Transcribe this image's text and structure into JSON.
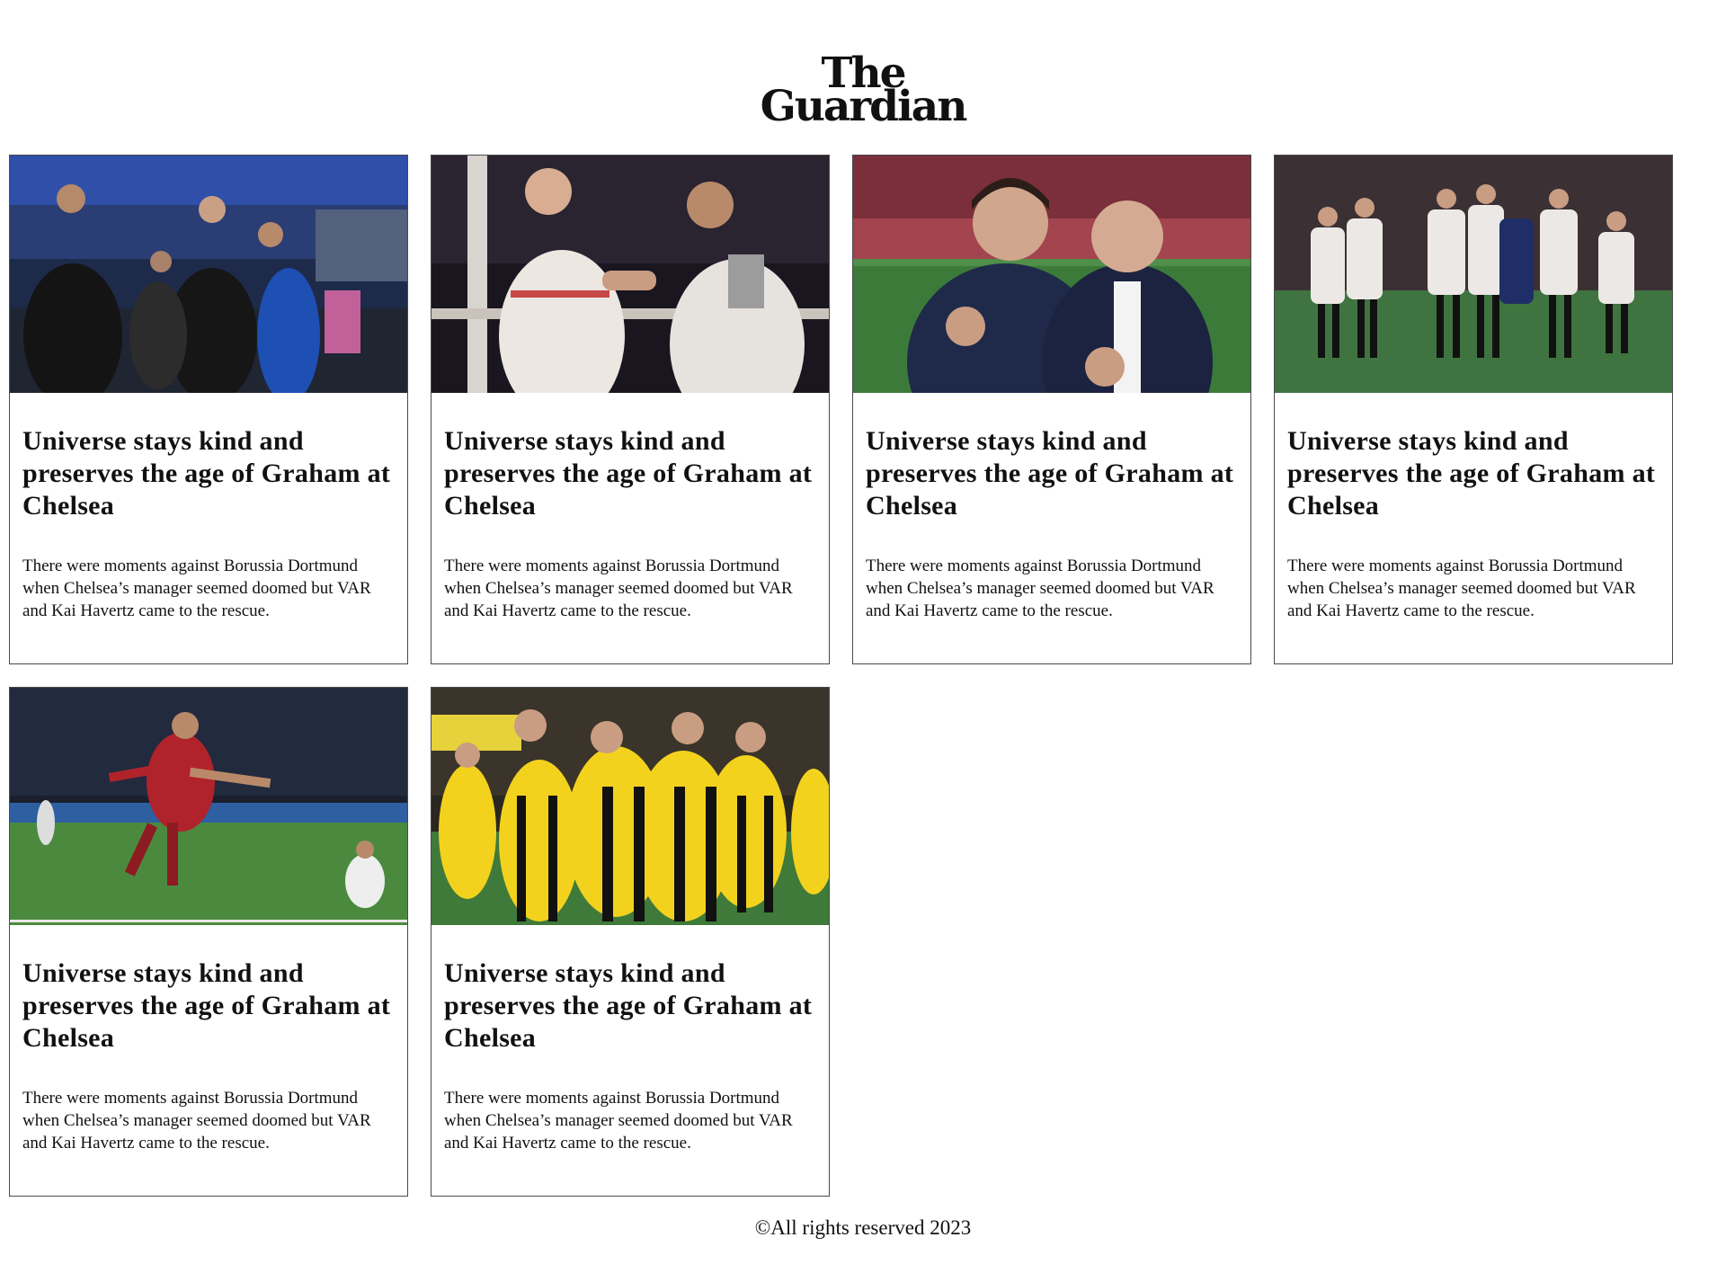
{
  "header": {
    "logo_line_1": "The",
    "logo_line_2": "Guardian"
  },
  "articles": [
    {
      "image": "chelsea-manager-celebrating-photo",
      "title": "Universe stays kind and preserves the age of Graham at Chelsea",
      "summary": "There were moments against Borussia Dortmund when Chelsea’s manager seemed doomed but VAR and Kai Havertz came to the rescue."
    },
    {
      "image": "england-rugby-players-handshake-photo",
      "title": "Universe stays kind and preserves the age of Graham at Chelsea",
      "summary": "There were moments against Borussia Dortmund when Chelsea’s manager seemed doomed but VAR and Kai Havertz came to the rescue."
    },
    {
      "image": "tottenham-manager-and-chairman-celebrating-photo",
      "title": "Universe stays kind and preserves the age of Graham at Chelsea",
      "summary": "There were moments against Borussia Dortmund when Chelsea’s manager seemed doomed but VAR and Kai Havertz came to the rescue."
    },
    {
      "image": "sevilla-players-dejected-photo",
      "title": "Universe stays kind and preserves the age of Graham at Chelsea",
      "summary": "There were moments against Borussia Dortmund when Chelsea’s manager seemed doomed but VAR and Kai Havertz came to the rescue."
    },
    {
      "image": "roma-player-goal-celebration-photo",
      "title": "Universe stays kind and preserves the age of Graham at Chelsea",
      "summary": "There were moments against Borussia Dortmund when Chelsea’s manager seemed doomed but VAR and Kai Havertz came to the rescue."
    },
    {
      "image": "dortmund-players-group-celebration-photo",
      "title": "Universe stays kind and preserves the age of Graham at Chelsea",
      "summary": "There were moments against Borussia Dortmund when Chelsea’s manager seemed doomed but VAR and Kai Havertz came to the rescue."
    }
  ],
  "footer": {
    "copyright": "©All rights reserved 2023"
  },
  "colors": {
    "page_background": "#ffffff",
    "text": "#111111",
    "card_border": "#4a4a4a"
  }
}
